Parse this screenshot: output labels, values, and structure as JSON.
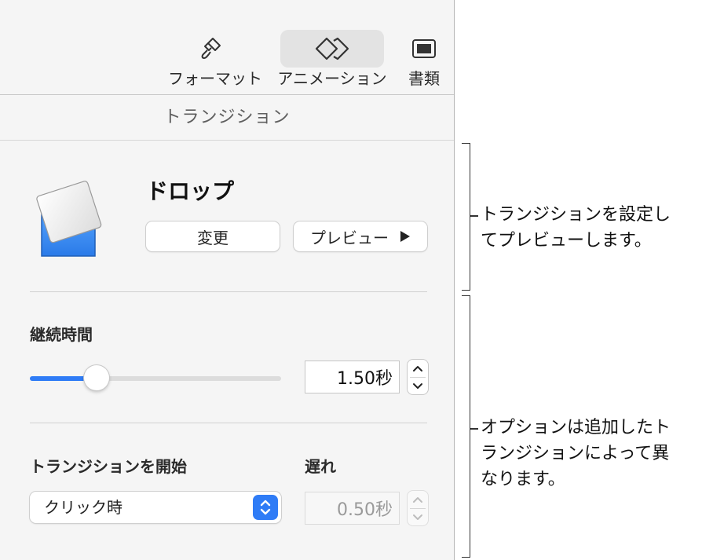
{
  "toolbar": {
    "format_label": "フォーマット",
    "animate_label": "アニメーション",
    "document_label": "書類",
    "format_icon": "paintbrush-icon",
    "animate_icon": "diamond-animate-icon",
    "document_icon": "document-icon"
  },
  "section": {
    "title": "トランジション"
  },
  "transition": {
    "name": "ドロップ",
    "change_label": "変更",
    "preview_label": "プレビュー",
    "preview_icon": "play-icon"
  },
  "duration": {
    "label": "継続時間",
    "value": "1.50秒",
    "slider_fraction": 0.26
  },
  "start": {
    "label": "トランジションを開始",
    "selected": "クリック時"
  },
  "delay": {
    "label": "遅れ",
    "value": "0.50秒"
  },
  "callouts": {
    "top_line1": "トランジションを設定し",
    "top_line2": "てプレビューします。",
    "bottom_line1": "オプションは追加したト",
    "bottom_line2": "ランジションによって異",
    "bottom_line3": "なります。"
  },
  "colors": {
    "accent": "#2f7cf6",
    "slide_blue": "#3b8ef0"
  }
}
